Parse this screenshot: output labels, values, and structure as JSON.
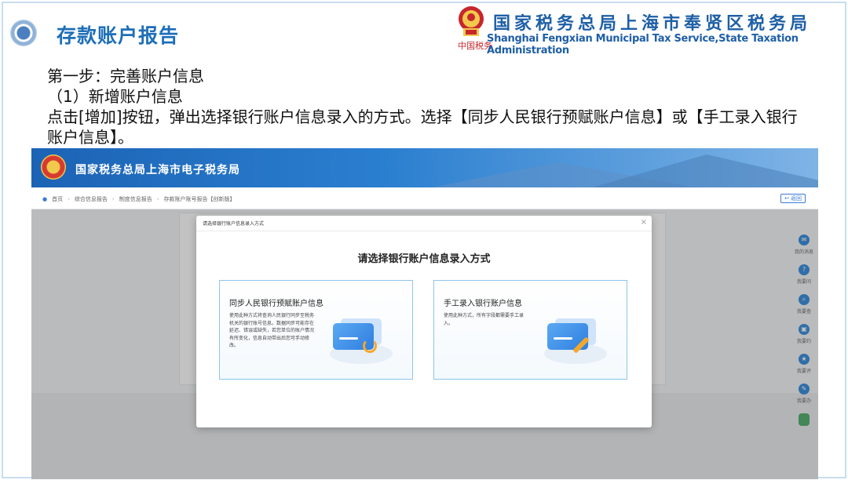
{
  "slide": {
    "title": "存款账户报告",
    "bureau_cn": "国家税务总局上海市奉贤区税务局",
    "bureau_en": "Shanghai Fengxian Municipal Tax Service,State Taxation  Administration",
    "emblem_sub": "中国税务",
    "step_line": "第一步：完善账户信息",
    "sub_line": "（1）新增账户信息",
    "instruction": "点击[增加]按钮，弹出选择银行账户信息录入的方式。选择【同步人民银行预赋账户信息】或【手工录入银行账户信息】。"
  },
  "portal": {
    "banner_title": "国家税务总局上海市电子税务局",
    "breadcrumbs": [
      "首页",
      "综合信息报告",
      "制度信息报告",
      "存款账户账号报告【创新版】"
    ],
    "back_label": "返回",
    "side_tools": [
      {
        "label": "我的消息",
        "icon": "message-icon"
      },
      {
        "label": "我要问",
        "icon": "question-icon"
      },
      {
        "label": "我要查",
        "icon": "search-icon"
      },
      {
        "label": "我要约",
        "icon": "calendar-icon"
      },
      {
        "label": "我要评",
        "icon": "star-icon"
      },
      {
        "label": "我要办",
        "icon": "edit-icon"
      }
    ]
  },
  "modal": {
    "header_title": "请选择银行账户信息录入方式",
    "close_glyph": "×",
    "title": "请选择银行账户信息录入方式",
    "options": [
      {
        "title": "同步人民银行预赋账户信息",
        "desc": "使用此种方式将查询人民银行同步至税务机关的银行账号信息。数据同步可能存在延迟、错误或缺失，若您单位的账户情况有所变化，信息自动带出后您可手动修改。"
      },
      {
        "title": "手工录入银行账户信息",
        "desc": "使用此种方式，所有字段都需要手工录入。"
      }
    ]
  },
  "colors": {
    "title_blue": "#1e6fb8",
    "bureau_blue": "#1e5fa6",
    "option_border": "#8ec5ea"
  }
}
